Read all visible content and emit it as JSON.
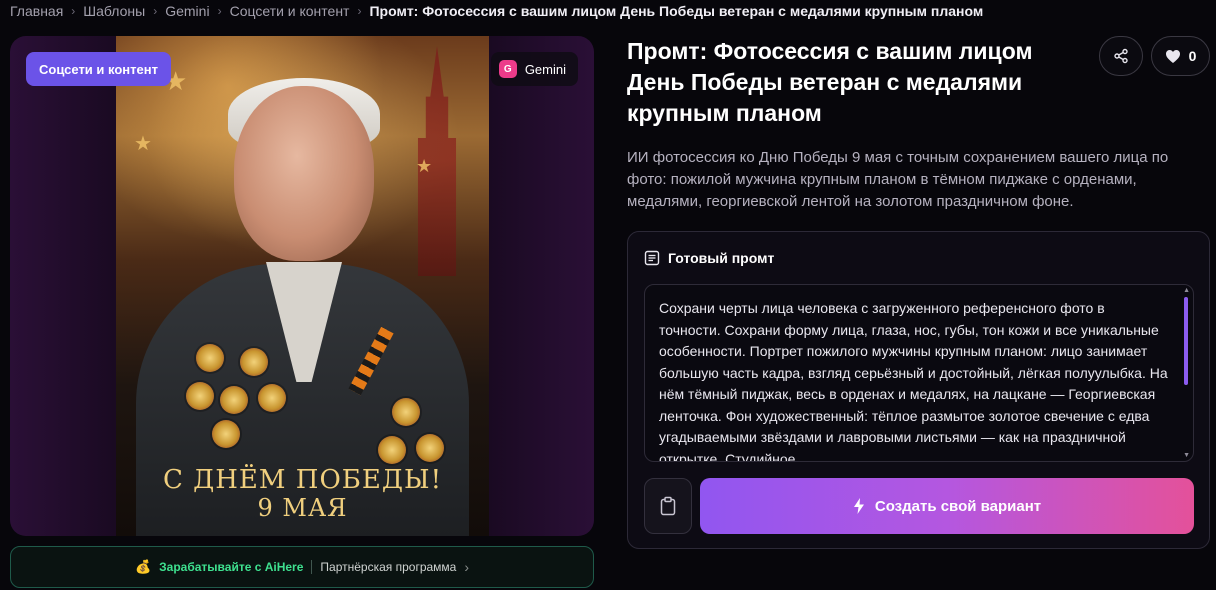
{
  "breadcrumb": {
    "items": [
      "Главная",
      "Шаблоны",
      "Gemini",
      "Соцсети и контент"
    ],
    "current": "Промт: Фотосессия с вашим лицом День Победы ветеран с медалями крупным планом"
  },
  "image_card": {
    "category_badge": "Соцсети и контент",
    "model_badge": {
      "icon_letter": "G",
      "label": "Gemini"
    },
    "poster_text": {
      "line1": "С ДНЁМ ПОБЕДЫ!",
      "line2": "9 МАЯ"
    }
  },
  "affiliate": {
    "earn_text": "Зарабатывайте с AiHere",
    "partner_text": "Партнёрская программа",
    "icon": "coin-bag-icon"
  },
  "title": "Промт: Фотосессия с вашим лицом День Победы ветеран с медалями крупным планом",
  "like_count": "0",
  "description": "ИИ фотосессия ко Дню Победы 9 мая с точным сохранением вашего лица по фото: пожилой мужчина крупным планом в тёмном пиджаке с орденами, медалями, георгиевской лентой на золотом праздничном фоне.",
  "prompt": {
    "heading": "Готовый промт",
    "text": "Сохрани черты лица человека с загруженного референсного фото в точности. Сохрани форму лица, глаза, нос, губы, тон кожи и все уникальные особенности. Портрет пожилого мужчины крупным планом: лицо занимает большую часть кадра, взгляд серьёзный и достойный, лёгкая полуулыбка. На нём тёмный пиджак, весь в орденах и медалях, на лацкане — Георгиевская ленточка. Фон художественный: тёплое размытое золотое свечение с едва угадываемыми звёздами и лавровыми листьями — как на праздничной открытке. Студийное"
  },
  "actions": {
    "create_label": "Создать свой вариант"
  },
  "colors": {
    "accent_purple": "#6b53e8",
    "gradient_start": "#9156f0",
    "gradient_end": "#e4519a",
    "affiliate_green": "#3ee08f"
  }
}
